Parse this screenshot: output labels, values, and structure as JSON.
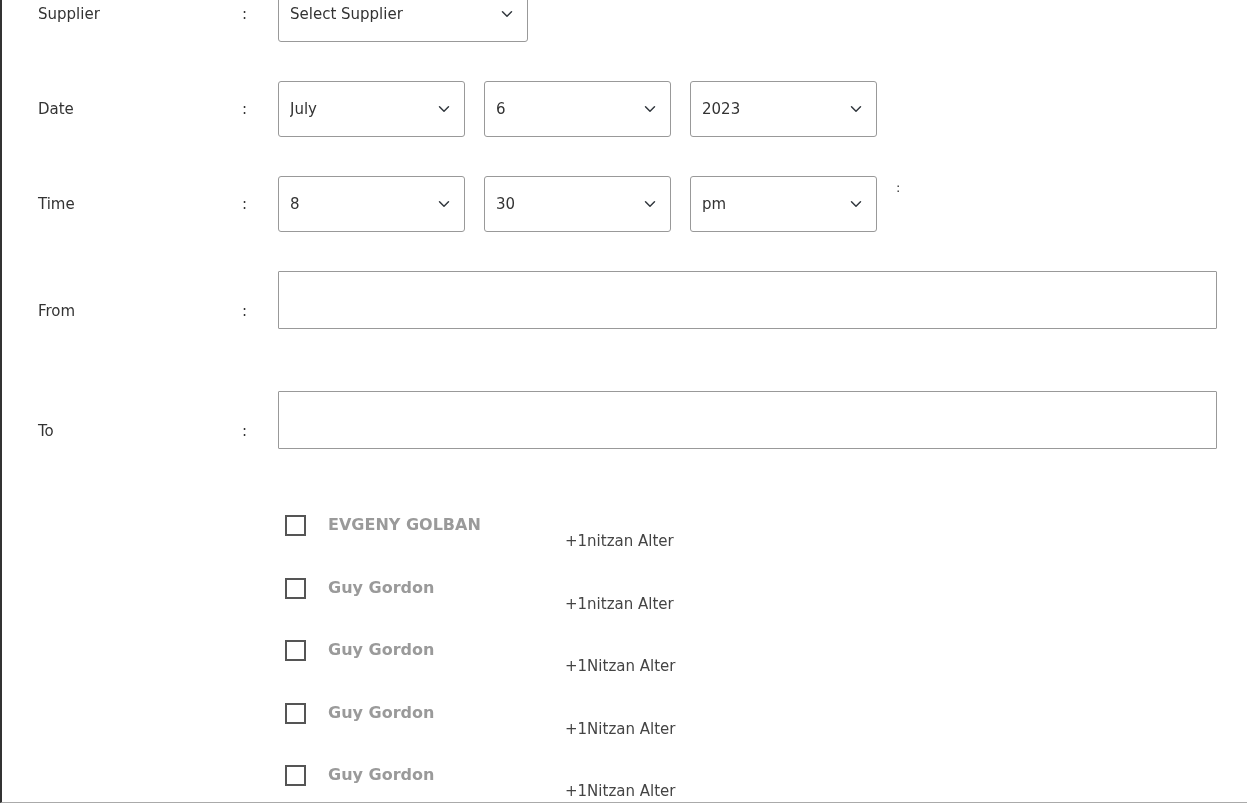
{
  "fields": [
    {
      "kind": "select",
      "label": "Supplier",
      "separator": ":",
      "controls": [
        {
          "value": "Select Supplier"
        }
      ]
    },
    {
      "kind": "select",
      "label": "Date",
      "separator": ":",
      "controls": [
        {
          "value": "July"
        },
        {
          "value": "6"
        },
        {
          "value": "2023"
        }
      ]
    },
    {
      "kind": "select",
      "label": "Time",
      "separator": ":",
      "controls": [
        {
          "value": "8"
        },
        {
          "value": "30"
        },
        {
          "value": "pm"
        }
      ],
      "suffix": ":"
    },
    {
      "kind": "text",
      "label": "From",
      "separator": ":"
    },
    {
      "kind": "text",
      "label": "To",
      "separator": ":"
    }
  ],
  "contacts": [
    {
      "name": "EVGENY GOLBAN",
      "phone": "+1nitzan Alter",
      "checked": false
    },
    {
      "name": "Guy Gordon",
      "phone": "+1nitzan Alter",
      "checked": false
    },
    {
      "name": "Guy Gordon",
      "phone": "+1Nitzan Alter",
      "checked": false
    },
    {
      "name": "Guy Gordon",
      "phone": "+1Nitzan Alter",
      "checked": false
    },
    {
      "name": "Guy Gordon",
      "phone": "+1Nitzan Alter",
      "checked": false
    }
  ]
}
